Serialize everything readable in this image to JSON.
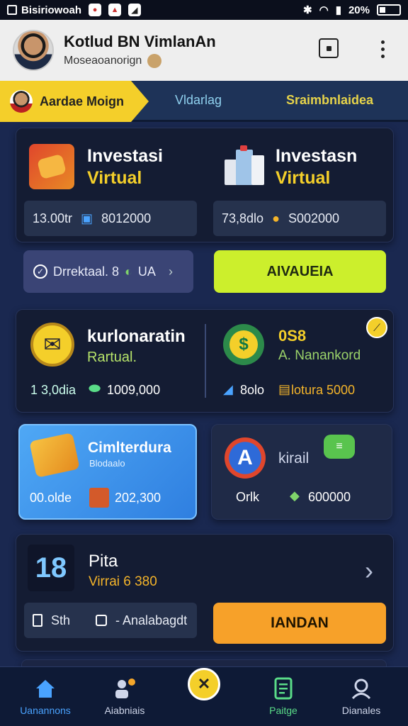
{
  "status_bar": {
    "carrier": "Bisiriowoah",
    "battery": "20%"
  },
  "header": {
    "title": "Kotlud BN VimlanAn",
    "subtitle": "Moseaoanorign"
  },
  "tabs": [
    {
      "label": "Aardae Moign",
      "active": true
    },
    {
      "label": "Vldarlag"
    },
    {
      "label": "Sraimbnlaidea"
    }
  ],
  "card1": {
    "left": {
      "title1": "Investasi",
      "title2": "Virtual",
      "stat1": "13.00tr",
      "stat2": "8012000"
    },
    "right": {
      "title1": "Investasn",
      "title2": "Virtual",
      "stat1": "73,8dlo",
      "stat2": "S002000"
    }
  },
  "actions": {
    "secondary_label": "Drrektaal. 8",
    "secondary_suffix": "UA",
    "primary_label": "AIVAUEIA"
  },
  "card2": {
    "left": {
      "title": "kurlonaratin",
      "subtitle": "Rartual.",
      "stat1": "1 3,0dia",
      "stat2": "1009,000"
    },
    "right": {
      "title": "0S8",
      "subtitle": "A. Nanankord",
      "stat1": "8olo",
      "stat2": "lotura 5000"
    }
  },
  "card3": {
    "title": "Cimlterdura",
    "subtitle": "Blodaalo",
    "stat1": "00.olde",
    "stat2": "202,300"
  },
  "card4": {
    "title": "kirail",
    "stat1": "Orlk",
    "stat2": "600000"
  },
  "card5": {
    "number": "18",
    "title": "Pita",
    "subtitle": "Virrai 6 380",
    "field1": "Sth",
    "field2": "- Analabagdt",
    "button": "IANDAN"
  },
  "nav": [
    {
      "label": "Uanannons",
      "active": true
    },
    {
      "label": "Aiabniais"
    },
    {
      "label": "Paitge"
    },
    {
      "label": "Dianales"
    }
  ],
  "colors": {
    "accent_yellow": "#f4cf2a",
    "accent_green": "#ccef2c",
    "accent_orange": "#f7a129",
    "background": "#1a2850",
    "card": "#141c33"
  }
}
